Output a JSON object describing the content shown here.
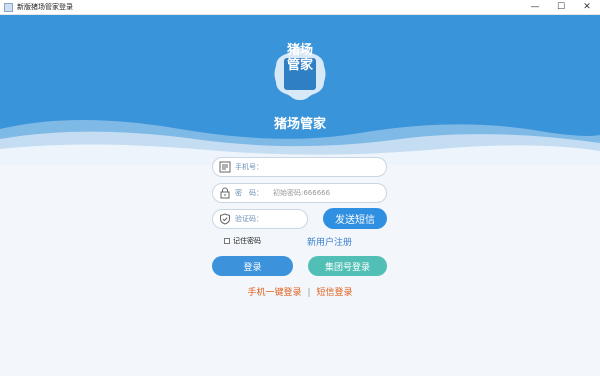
{
  "window": {
    "title": "新版猪场管家登录",
    "minimize_glyph": "—",
    "maximize_glyph": "☐",
    "close_glyph": "✕"
  },
  "brand": {
    "logo_line1": "猪场",
    "logo_line2": "管家",
    "app_name": "猪场管家"
  },
  "form": {
    "phone": {
      "label": "手机号：",
      "value": "",
      "placeholder": ""
    },
    "password": {
      "label": "密　码：",
      "value": "",
      "placeholder": "初始密码:666666"
    },
    "code": {
      "label": "验证码：",
      "value": "",
      "placeholder": ""
    },
    "send_sms_label": "发送短信",
    "remember_label": "记住密码",
    "register_label": "新用户注册",
    "login_label": "登录",
    "group_login_label": "集团号登录"
  },
  "links": {
    "one_click_login": "手机一键登录",
    "separator": "|",
    "sms_login": "短信登录"
  },
  "colors": {
    "header_blue": "#3a94d9",
    "sms_button": "#2f8fe0",
    "login_button": "#3c93dc",
    "group_button": "#52bfb6",
    "link_orange": "#e0601a"
  },
  "icons": {
    "phone": "phone-card-icon",
    "password": "lock-icon",
    "code": "shield-check-icon"
  }
}
